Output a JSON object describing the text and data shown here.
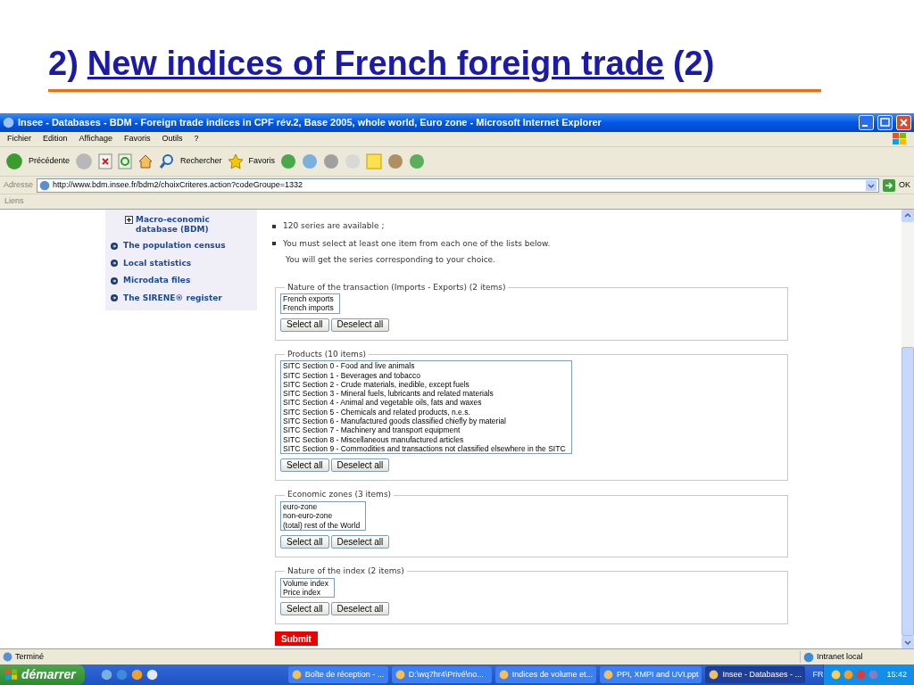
{
  "slide": {
    "number": "2)",
    "link": "New indices of French foreign trade",
    "suffix": "(2)"
  },
  "window": {
    "title": "Insee - Databases - BDM - Foreign trade indices in CPF rév.2, Base 2005, whole world, Euro zone - Microsoft Internet Explorer"
  },
  "menu": [
    "Fichier",
    "Edition",
    "Affichage",
    "Favoris",
    "Outils",
    "?"
  ],
  "toolbar": {
    "back": "Précédente",
    "search": "Rechercher",
    "favorites": "Favoris"
  },
  "address": {
    "label": "Adresse",
    "value": "http://www.bdm.insee.fr/bdm2/choixCriteres.action?codeGroupe=1332",
    "go": "OK"
  },
  "links_bar": "Liens",
  "sidebar": [
    {
      "label": "Macro-economic database (BDM)",
      "kind": "expand"
    },
    {
      "label": "The population census",
      "kind": "link"
    },
    {
      "label": "Local statistics",
      "kind": "link"
    },
    {
      "label": "Microdata files",
      "kind": "link"
    },
    {
      "label": "The SIRENE® register",
      "kind": "link"
    }
  ],
  "intro": [
    "120 series are available ;",
    "You must select at least one item from each one of the lists below."
  ],
  "intro_note": "You will get the series corresponding to your choice.",
  "groups": [
    {
      "legend": "Nature of the transaction (Imports - Exports) (2 items)",
      "items": [
        "French exports",
        "French imports"
      ],
      "select_all": "Select all",
      "deselect_all": "Deselect all"
    },
    {
      "legend": "Products (10 items)",
      "items": [
        "SITC Section 0 - Food and live animals",
        "SITC Section 1 - Beverages and tobacco",
        "SITC Section 2 - Crude materials, inedible, except fuels",
        "SITC Section 3 - Mineral fuels, lubricants and related materials",
        "SITC Section 4 - Animal and vegetable oils, fats and waxes",
        "SITC Section 5 - Chemicals and related products, n.e.s.",
        "SITC Section 6 - Manufactured goods classified chiefly by material",
        "SITC Section 7 - Machinery and transport equipment",
        "SITC Section 8 - Miscellaneous manufactured articles",
        "SITC Section 9 - Commodities and transactions not classified elsewhere in the SITC"
      ],
      "select_all": "Select all",
      "deselect_all": "Deselect all"
    },
    {
      "legend": "Economic zones (3 items)",
      "items": [
        "euro-zone",
        "non-euro-zone",
        "(total) rest of the World"
      ],
      "select_all": "Select all",
      "deselect_all": "Deselect all"
    },
    {
      "legend": "Nature of the index (2 items)",
      "items": [
        "Volume index",
        "Price index"
      ],
      "select_all": "Select all",
      "deselect_all": "Deselect all"
    }
  ],
  "submit": "Submit",
  "status": {
    "text": "Terminé",
    "zone": "Intranet local"
  },
  "taskbar": {
    "start": "démarrer",
    "tasks": [
      {
        "label": "Boîte de réception - ...",
        "selected": false
      },
      {
        "label": "D:\\wq7hr4\\Privé\\no...",
        "selected": false
      },
      {
        "label": "Indices de volume et...",
        "selected": false
      },
      {
        "label": "PPI, XMPI and UVI.ppt",
        "selected": false
      },
      {
        "label": "Insee - Databases - ...",
        "selected": true
      }
    ],
    "language": "FR",
    "clock": "15:42"
  }
}
